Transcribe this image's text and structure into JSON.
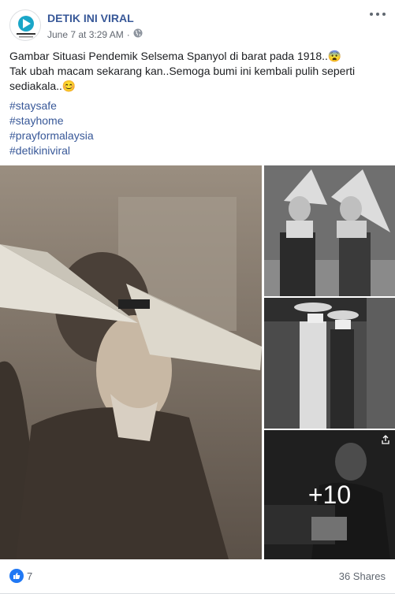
{
  "post": {
    "page_name": "DETIK INI VIRAL",
    "timestamp": "June 7 at 3:29 AM",
    "separator": "·",
    "privacy_icon": "globe-icon",
    "text_line1": "Gambar Situasi Pendemik Selsema Spanyol di barat pada 1918..😨",
    "text_line2": "Tak ubah macam sekarang kan..Semoga bumi ini kembali pulih seperti sediakala..😊",
    "hashtags": [
      "#staysafe",
      "#stayhome",
      "#prayformalaysia",
      "#detikiniviral"
    ]
  },
  "photos": {
    "more_count": "+10"
  },
  "footer": {
    "like_count": "7",
    "shares": "36 Shares"
  },
  "colors": {
    "link": "#385898",
    "like": "#2078f4"
  }
}
